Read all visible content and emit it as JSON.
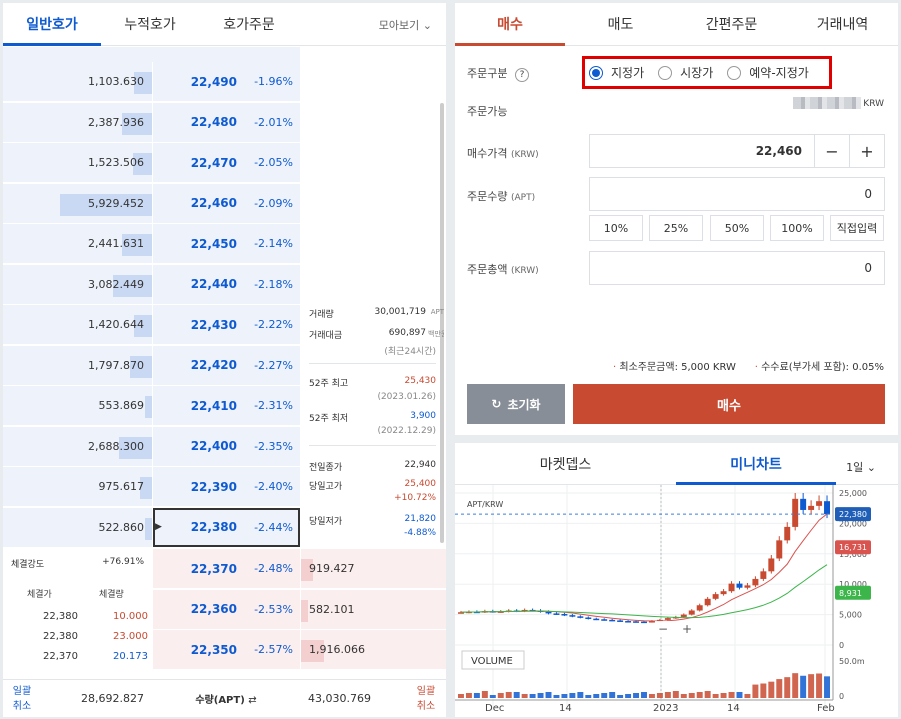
{
  "left_tabs": [
    "일반호가",
    "누적호가",
    "호가주문"
  ],
  "view_dropdown": "모아보기",
  "asks": [
    {
      "vol": "1,103.630",
      "price": "22,490",
      "rate": "-1.96%",
      "fill": 0.12
    },
    {
      "vol": "2,387.936",
      "price": "22,480",
      "rate": "-2.01%",
      "fill": 0.2
    },
    {
      "vol": "1,523.506",
      "price": "22,470",
      "rate": "-2.05%",
      "fill": 0.13
    },
    {
      "vol": "5,929.452",
      "price": "22,460",
      "rate": "-2.09%",
      "fill": 0.62
    },
    {
      "vol": "2,441.631",
      "price": "22,450",
      "rate": "-2.14%",
      "fill": 0.2
    },
    {
      "vol": "3,082.449",
      "price": "22,440",
      "rate": "-2.18%",
      "fill": 0.26
    },
    {
      "vol": "1,420.644",
      "price": "22,430",
      "rate": "-2.22%",
      "fill": 0.12
    },
    {
      "vol": "1,797.870",
      "price": "22,420",
      "rate": "-2.27%",
      "fill": 0.15
    },
    {
      "vol": "553.869",
      "price": "22,410",
      "rate": "-2.31%",
      "fill": 0.05
    },
    {
      "vol": "2,688.300",
      "price": "22,400",
      "rate": "-2.35%",
      "fill": 0.22
    },
    {
      "vol": "975.617",
      "price": "22,390",
      "rate": "-2.40%",
      "fill": 0.08
    },
    {
      "vol": "522.860",
      "price": "22,380",
      "rate": "-2.44%",
      "fill": 0.05
    }
  ],
  "bids": [
    {
      "vol": "919.427",
      "price": "22,370",
      "rate": "-2.48%",
      "fill": 0.08
    },
    {
      "vol": "582.101",
      "price": "22,360",
      "rate": "-2.53%",
      "fill": 0.05
    },
    {
      "vol": "1,916.066",
      "price": "22,350",
      "rate": "-2.57%",
      "fill": 0.16
    }
  ],
  "stats": {
    "volume_label": "거래량",
    "volume_value": "30,001,719",
    "volume_unit": "APT",
    "amount_label": "거래대금",
    "amount_value": "690,897",
    "amount_unit": "백만원",
    "amount_note": "(최근24시간)",
    "high52_label": "52주 최고",
    "high52_value": "25,430",
    "high52_date": "(2023.01.26)",
    "low52_label": "52주 최저",
    "low52_value": "3,900",
    "low52_date": "(2022.12.29)",
    "prev_close_label": "전일종가",
    "prev_close_value": "22,940",
    "day_high_label": "당일고가",
    "day_high_value": "25,400",
    "day_high_rate": "+10.72%",
    "day_low_label": "당일저가",
    "day_low_value": "21,820",
    "day_low_rate": "-4.88%"
  },
  "trades": {
    "strength_label": "체결강도",
    "strength_value": "+76.91%",
    "price_header": "체결가",
    "qty_header": "체결량",
    "rows": [
      {
        "price": "22,380",
        "qty": "10.000",
        "side": "red"
      },
      {
        "price": "22,380",
        "qty": "23.000",
        "side": "red"
      },
      {
        "price": "22,370",
        "qty": "20.173",
        "side": "blue"
      }
    ]
  },
  "footer": {
    "cancel_left": "일괄\n취소",
    "ask_total": "28,692.827",
    "qty_label": "수량(APT)",
    "bid_total": "43,030.769",
    "cancel_right": "일괄\n취소"
  },
  "order_tabs": [
    "매수",
    "매도",
    "간편주문",
    "거래내역"
  ],
  "order": {
    "type_label": "주문구분",
    "types": [
      "지정가",
      "시장가",
      "예약-지정가"
    ],
    "available_label": "주문가능",
    "available_unit": "KRW",
    "price_label": "매수가격",
    "price_unit": "(KRW)",
    "price_value": "22,460",
    "qty_label": "주문수량",
    "qty_unit": "(APT)",
    "qty_value": "0",
    "pct": [
      "10%",
      "25%",
      "50%",
      "100%",
      "직접입력"
    ],
    "total_label": "주문총액",
    "total_unit": "(KRW)",
    "total_value": "0",
    "min_note": "최소주문금액: 5,000 KRW",
    "fee_note": "수수료(부가세 포함): 0.05%",
    "reset": "초기화",
    "buy": "매수"
  },
  "chart_tabs": [
    "마켓뎁스",
    "미니차트"
  ],
  "interval": "1일",
  "chart_data": {
    "type": "candlestick",
    "pair": "APT/KRW",
    "y_ticks": [
      "25,000",
      "20,000",
      "15,000",
      "10,000",
      "5,000",
      "0"
    ],
    "x_ticks": [
      "Dec",
      "14",
      "2023",
      "14",
      "Feb"
    ],
    "last_price": "22,380",
    "ma_long": "16,731",
    "ma_short": "8,931",
    "volume_label": "VOLUME",
    "volume_ticks": [
      "50.0m",
      "0"
    ],
    "closes": [
      5600,
      5700,
      5650,
      5800,
      5700,
      5750,
      5900,
      5800,
      6000,
      5900,
      5700,
      5400,
      5300,
      5100,
      4900,
      4700,
      4500,
      4400,
      4300,
      4200,
      4100,
      4050,
      4000,
      3950,
      4100,
      4300,
      4600,
      4800,
      5200,
      5900,
      6800,
      7900,
      8700,
      9200,
      10500,
      9800,
      10200,
      11300,
      12600,
      14800,
      17900,
      20200,
      25000,
      23100,
      23800,
      24600,
      22380
    ],
    "ylim": [
      0,
      26000
    ]
  }
}
